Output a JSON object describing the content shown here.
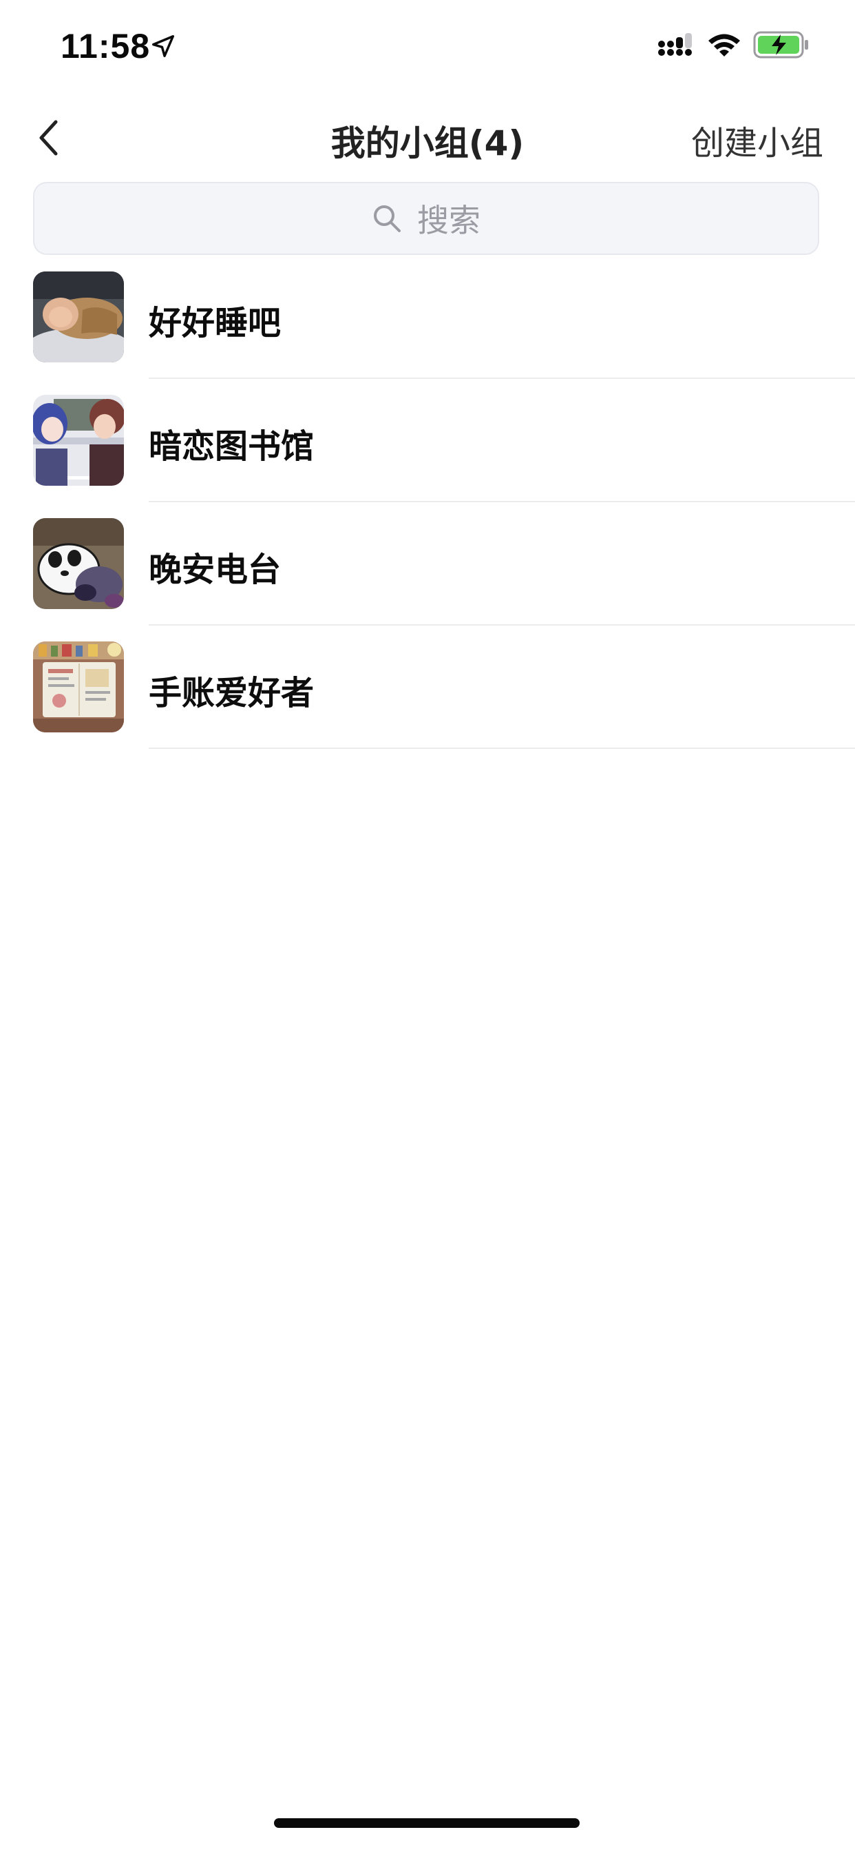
{
  "status_bar": {
    "time": "11:58"
  },
  "nav": {
    "title": "我的小组(4)",
    "create_label": "创建小组"
  },
  "search": {
    "placeholder": "搜索"
  },
  "groups": [
    {
      "name": "好好睡吧"
    },
    {
      "name": "暗恋图书馆"
    },
    {
      "name": "晚安电台"
    },
    {
      "name": "手账爱好者"
    }
  ],
  "colors": {
    "battery_fill": "#5fd35a",
    "search_bg": "#f4f5f9",
    "divider": "#ececec"
  },
  "icons": {
    "back": "chevron-left-icon",
    "search": "search-icon",
    "location": "location-arrow-icon",
    "signal": "signal-icon",
    "wifi": "wifi-icon",
    "battery": "battery-charging-icon"
  }
}
